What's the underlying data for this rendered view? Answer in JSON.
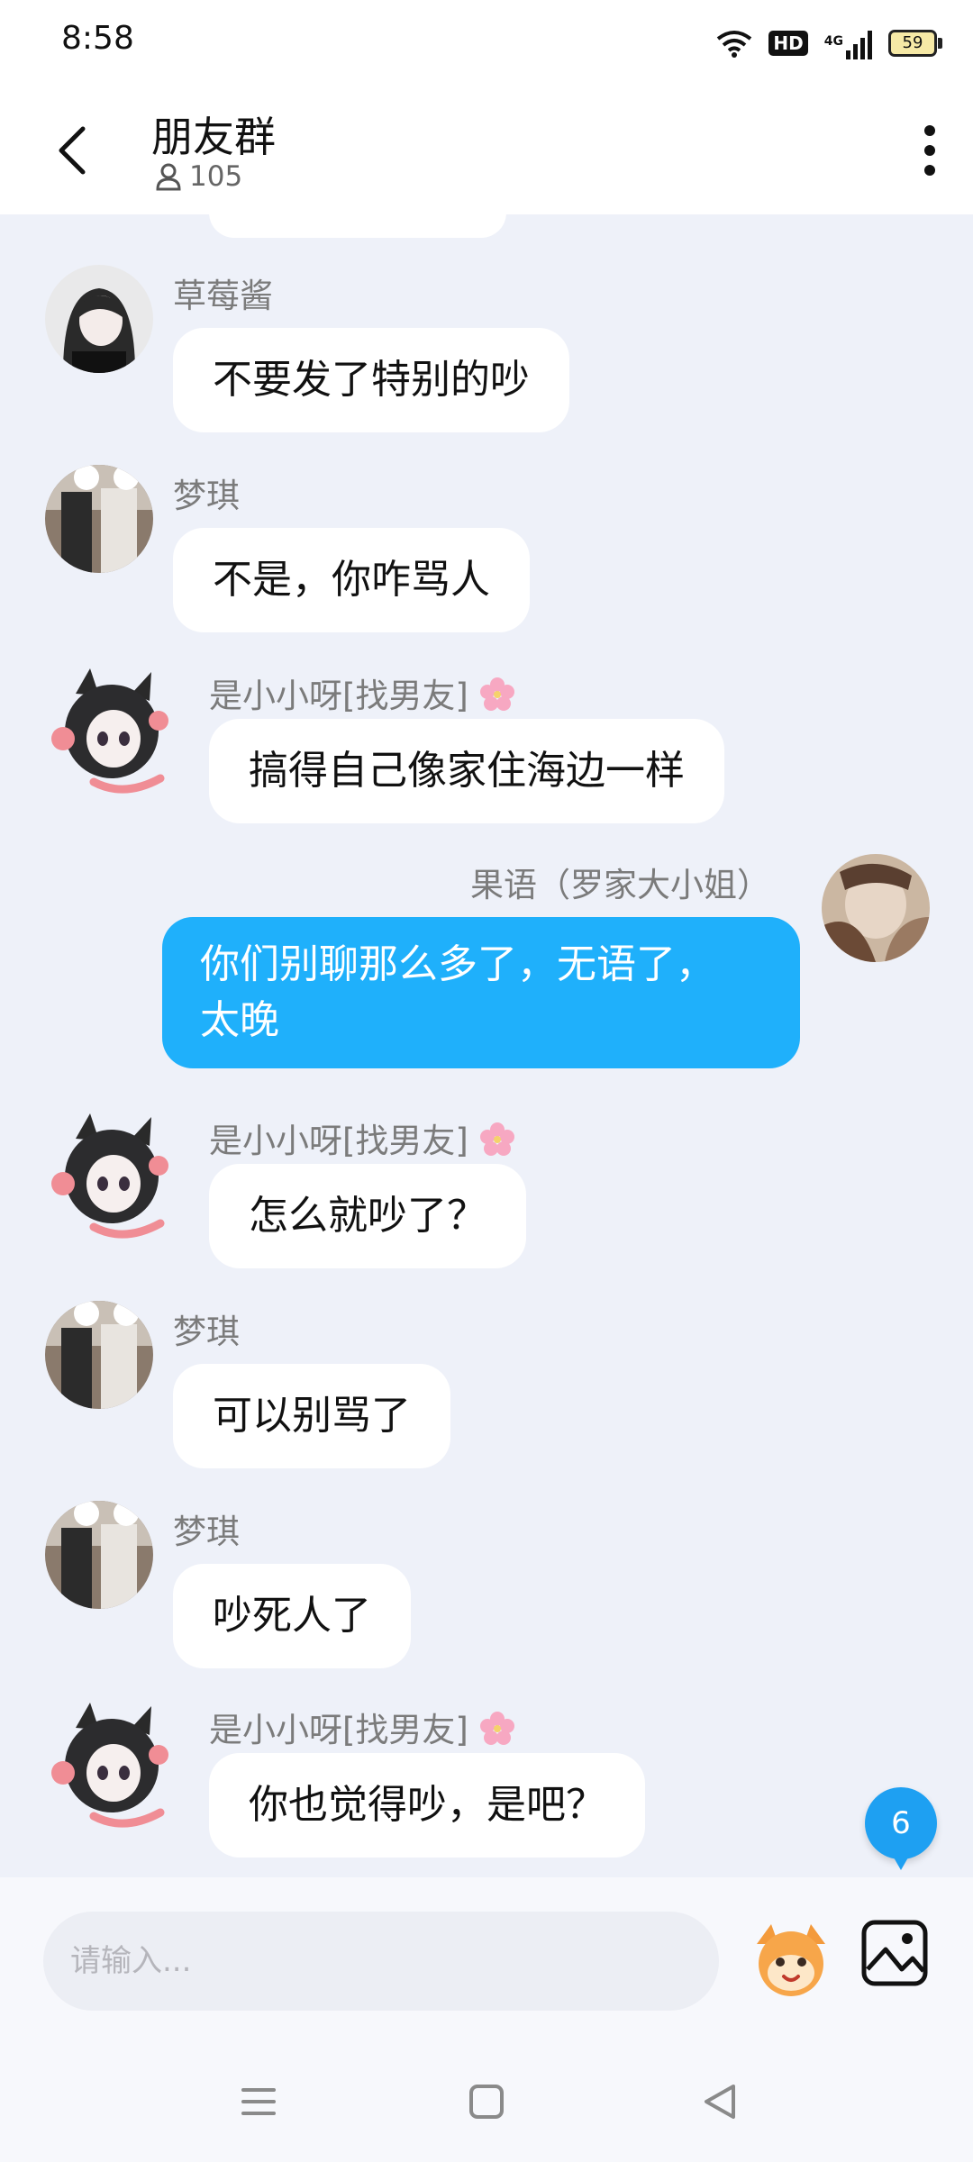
{
  "status_bar": {
    "time": "8:58",
    "net": "4G",
    "hd": "HD",
    "battery": "59"
  },
  "header": {
    "title": "朋友群",
    "member_count": "105"
  },
  "messages": [
    {
      "sender": "草莓酱",
      "text": "不要发了特别的吵"
    },
    {
      "sender": "梦琪",
      "text": "不是，你咋骂人"
    },
    {
      "sender": "是小小呀[找男友]",
      "text": "搞得自己像家住海边一样"
    },
    {
      "sender": "果语（罗家大小姐）",
      "line1": "你们别聊那么多了，无语了，",
      "line2": "太晚"
    },
    {
      "sender": "是小小呀[找男友]",
      "text": "怎么就吵了？"
    },
    {
      "sender": "梦琪",
      "text": "可以别骂了"
    },
    {
      "sender": "梦琪",
      "text": "吵死人了"
    },
    {
      "sender": "是小小呀[找男友]",
      "text": "你也觉得吵，是吧？"
    }
  ],
  "unread_count": "6",
  "input": {
    "placeholder": "请输入..."
  },
  "colors": {
    "my_bubble": "#1fb0fb",
    "chat_bg": "#eef1f9",
    "badge": "#1ea0f2"
  },
  "icons": [
    "wifi-icon",
    "signal-icon",
    "battery-icon",
    "back-icon",
    "person-icon",
    "more-icon",
    "sakura-icon",
    "emoji-icon",
    "image-icon",
    "menu-nav-icon",
    "home-nav-icon",
    "back-nav-icon"
  ]
}
